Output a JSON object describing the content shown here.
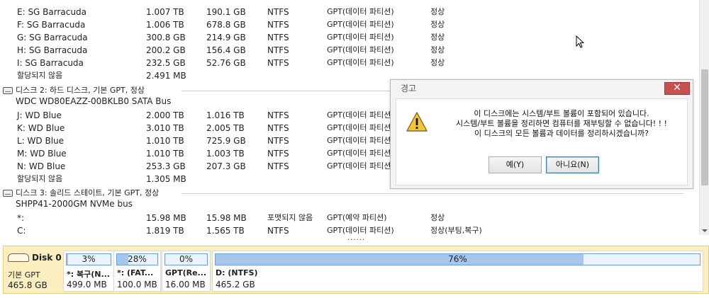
{
  "disk1_rows": [
    {
      "name": "E: SG Barracuda",
      "capacity": "1.007 TB",
      "used": "190.1 GB",
      "fs": "NTFS",
      "type": "GPT(데이터 파티션)",
      "status": "정상"
    },
    {
      "name": "F: SG Barracuda",
      "capacity": "1.006 TB",
      "used": "678.8 GB",
      "fs": "NTFS",
      "type": "GPT(데이터 파티션)",
      "status": "정상"
    },
    {
      "name": "G: SG Barracuda",
      "capacity": "300.8 GB",
      "used": "214.9 GB",
      "fs": "NTFS",
      "type": "GPT(데이터 파티션)",
      "status": "정상"
    },
    {
      "name": "H: SG Barracuda",
      "capacity": "200.2 GB",
      "used": "156.4 GB",
      "fs": "NTFS",
      "type": "GPT(데이터 파티션)",
      "status": "정상"
    },
    {
      "name": "I: SG Barracuda",
      "capacity": "232.5 GB",
      "used": "52.76 GB",
      "fs": "NTFS",
      "type": "GPT(데이터 파티션)",
      "status": "정상"
    }
  ],
  "disk1_unalloc": {
    "name": "할당되지 않음",
    "capacity": "2.491 MB"
  },
  "disk2": {
    "title": "디스크 2: 하드 디스크, 기본 GPT, 정상",
    "model": "WDC WD80EAZZ-00BKLB0 SATA Bus",
    "rows": [
      {
        "name": "J: WD Blue",
        "capacity": "2.000 TB",
        "used": "1.016 TB",
        "fs": "NTFS",
        "type": "GPT(데이터 파티션"
      },
      {
        "name": "K: WD Blue",
        "capacity": "3.010 TB",
        "used": "2.005 TB",
        "fs": "NTFS",
        "type": "GPT(데이터 파티션"
      },
      {
        "name": "L: WD Blue",
        "capacity": "1.010 TB",
        "used": "725.9 GB",
        "fs": "NTFS",
        "type": "GPT(데이터 파티션"
      },
      {
        "name": "M: WD Blue",
        "capacity": "1.010 TB",
        "used": "1.003 TB",
        "fs": "NTFS",
        "type": "GPT(데이터 파티션"
      },
      {
        "name": "N: WD Blue",
        "capacity": "253.3 GB",
        "used": "207.3 GB",
        "fs": "NTFS",
        "type": "GPT(데이터 파티션"
      }
    ],
    "unalloc": {
      "name": "할당되지 않음",
      "capacity": "1.305 MB"
    }
  },
  "disk3": {
    "title": "디스크 3: 솔리드 스테이트, 기본 GPT, 정상",
    "model": "SHPP41-2000GM NVMe bus",
    "rows": [
      {
        "name": "*:",
        "capacity": "15.98 MB",
        "used": "15.98 MB",
        "fs": "포맷되지 않음",
        "type": "GPT(예약 파티션)",
        "status": "정상"
      },
      {
        "name": "C:",
        "capacity": "1.819 TB",
        "used": "1.565 TB",
        "fs": "NTFS",
        "type": "GPT(데이터 파티션)",
        "status": "정상(부팅,복구)"
      }
    ],
    "more": "......"
  },
  "dialog": {
    "title": "경고",
    "close_label": "✕",
    "warning_icon": "warning-triangle-icon",
    "message_lines": [
      "이 디스크에는 시스템/부트 볼륨이 포함되어 있습니다.",
      "시스템/부트 볼륨을 정리하면 컴퓨터를 재부팅할 수 없습니다! ! !",
      "이 디스크의 모든 볼륨과 데이터를 정리하시겠습니까?"
    ],
    "yes_label": "예(Y)",
    "no_label": "아니요(N)"
  },
  "diskmap": {
    "disk_name": "Disk 0",
    "disk_type": "기본 GPT",
    "disk_size": "465.8 GB",
    "partitions": [
      {
        "percent_label": "3%",
        "percent": 3,
        "label": "*: 복구(N...",
        "size": "499.0 MB"
      },
      {
        "percent_label": "28%",
        "percent": 28,
        "label": "*: (FAT...",
        "size": "100.0 MB"
      },
      {
        "percent_label": "0%",
        "percent": 0,
        "label": "GPT(Re...",
        "size": "16.00 MB"
      },
      {
        "percent_label": "76%",
        "percent": 76,
        "label": "D: (NTFS)",
        "size": "465.2 GB"
      }
    ]
  },
  "colors": {
    "accent_blue": "#6aa0d8",
    "fill_blue": "#a7c6ec",
    "diskmap_bg": "#fbefbf",
    "close_red": "#c75050"
  }
}
